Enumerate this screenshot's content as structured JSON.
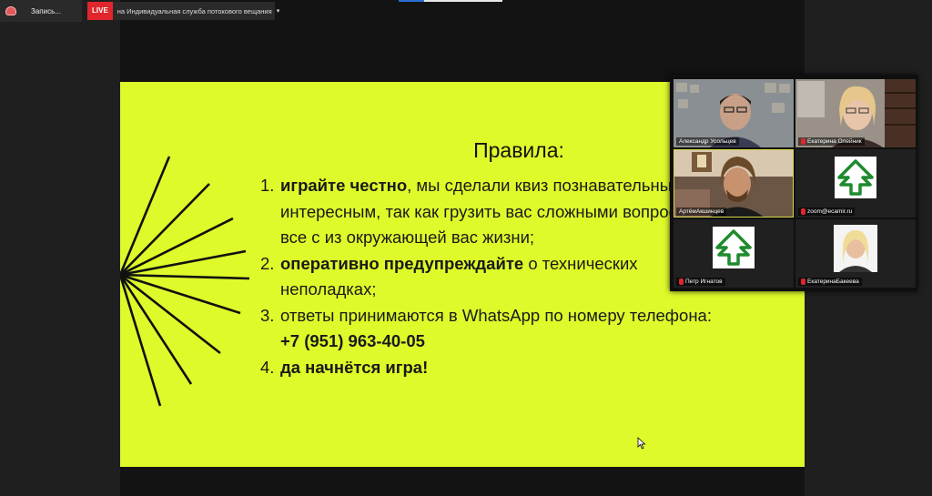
{
  "toolbar": {
    "recording_label": "Запись...",
    "live_badge": "LIVE",
    "stream_label": "на Индивидуальная служба потокового вещания",
    "stream_caret": "▾"
  },
  "slide": {
    "title": "Правила:",
    "rules": [
      {
        "num": "1.",
        "bold": "играйте честно",
        "text": ", мы сделали квиз познавательным и интересным, так как грузить вас сложными вопросами, все с из окружающей вас жизни;"
      },
      {
        "num": "2.",
        "bold": "оперативно предупреждайте",
        "text": " о технических неполадках;"
      },
      {
        "num": "3.",
        "bold": "",
        "text": "ответы принимаются в WhatsApp по номеру телефона: ",
        "bold2": "+7 (951) 963-40-05"
      },
      {
        "num": "4.",
        "bold": "да начнётся игра!",
        "text": ""
      }
    ],
    "background_color": "#defa2a"
  },
  "participants": [
    {
      "name": "Александр Усольцев",
      "muted": false,
      "type": "video"
    },
    {
      "name": "Екатерина Олейник",
      "muted": true,
      "type": "video"
    },
    {
      "name": "АртёмАкшинцев",
      "muted": false,
      "type": "video",
      "active": true
    },
    {
      "name": "zoom@ecamir.ru",
      "muted": true,
      "type": "avatar",
      "icon": "tree-arrow-icon"
    },
    {
      "name": "Петр Игнатов",
      "muted": true,
      "type": "avatar",
      "icon": "tree-arrow-icon"
    },
    {
      "name": "ЕкатеринаБакеева",
      "muted": true,
      "type": "video"
    }
  ]
}
